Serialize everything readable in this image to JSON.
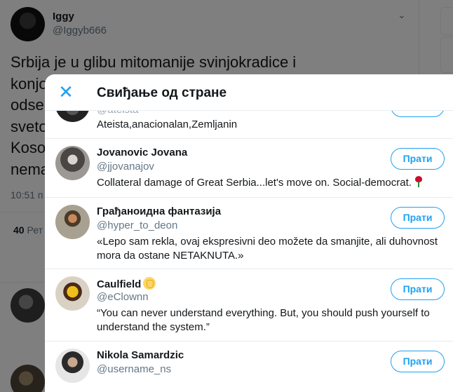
{
  "background": {
    "author_name": "Iggy",
    "author_handle": "@Iggyb666",
    "tweet_lines": [
      "Srbija je u glibu mitomanije svinjokradice i",
      "konjo",
      "odse",
      "sveto",
      "Koso",
      "nema"
    ],
    "time_fragment": "10:51 п",
    "stats_count": "40",
    "stats_label": "Рет"
  },
  "modal": {
    "title": "Свиђање од стране",
    "close_glyph": "✕"
  },
  "users": [
    {
      "name": "",
      "handle": "@ateista",
      "bio": "Ateista,anacionalan,Zemljanin",
      "follow_label": ""
    },
    {
      "name": "Jovanovic Jovana",
      "handle": "@jjovanajov",
      "bio": "Collateral damage of Great Serbia...let's move on. Social-democrat.",
      "follow_label": "Прати",
      "bio_emoji": "rose-icon"
    },
    {
      "name": "Грађаноидна фантазија",
      "handle": "@hyper_to_deon",
      "bio": "«Lepo sam rekla, ovaj ekspresivni deo možete da smanjite, ali duhovnost mora da ostane NETAKNUTA.»",
      "follow_label": "Прати"
    },
    {
      "name": "Caulfield",
      "handle": "@eClownn",
      "bio": "“You can never understand everything. But, you should push yourself to understand the system.”",
      "follow_label": "Прати",
      "name_emoji": "raised-fist-icon"
    },
    {
      "name": "Nikola Samardzic",
      "handle": "@username_ns",
      "bio": "",
      "follow_label": "Прати"
    }
  ],
  "colors": {
    "accent": "#1da1f2",
    "text": "#14171a",
    "muted": "#657786",
    "divider": "#e6ecf0"
  }
}
